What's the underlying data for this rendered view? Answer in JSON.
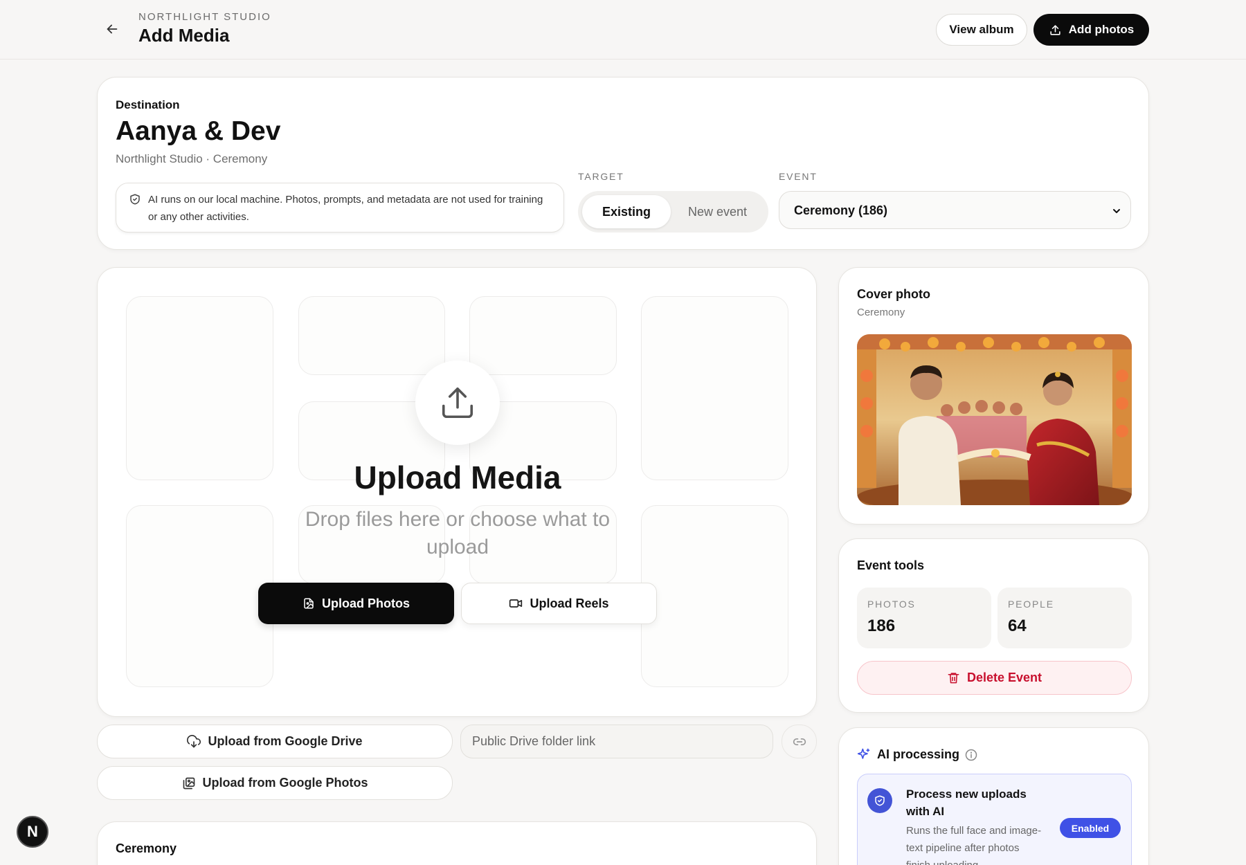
{
  "header": {
    "studio": "NORTHLIGHT STUDIO",
    "title": "Add Media",
    "view_album": "View album",
    "add_photos": "Add photos"
  },
  "destination": {
    "label": "Destination",
    "title": "Aanya & Dev",
    "subtitle": "Northlight Studio · Ceremony",
    "privacy_note": "AI runs on our local machine. Photos, prompts, and metadata are not used for training or any other activities.",
    "target_label": "TARGET",
    "target_options": [
      "Existing",
      "New event"
    ],
    "target_selected": "Existing",
    "event_label": "EVENT",
    "event_selected": "Ceremony (186)"
  },
  "upload": {
    "title": "Upload Media",
    "description": "Drop files here or choose what to upload",
    "upload_photos": "Upload Photos",
    "upload_reels": "Upload Reels",
    "google_drive": "Upload from Google Drive",
    "google_photos": "Upload from Google Photos",
    "drive_placeholder": "Public Drive folder link"
  },
  "ceremony_section": {
    "title": "Ceremony"
  },
  "cover": {
    "title": "Cover photo",
    "subtitle": "Ceremony"
  },
  "tools": {
    "title": "Event tools",
    "photos_label": "PHOTOS",
    "photos_value": "186",
    "people_label": "PEOPLE",
    "people_value": "64",
    "delete": "Delete Event"
  },
  "ai": {
    "title": "AI processing",
    "box_title": "Process new uploads with AI",
    "box_desc": "Runs the full face and image-text pipeline after photos finish uploading",
    "toggle": "Enabled"
  },
  "badge": {
    "letter": "N"
  },
  "colors": {
    "primary": "#0b0b0b",
    "danger": "#c8102e",
    "ai_accent": "#3f51e6",
    "background": "#f7f6f5"
  },
  "icons": {
    "back": "arrow-left-icon",
    "upload": "upload-icon",
    "shield": "shield-check-icon",
    "chevron": "chevron-down-icon",
    "photo": "image-file-icon",
    "video": "video-camera-icon",
    "cloud": "cloud-download-icon",
    "gallery": "gallery-icon",
    "link": "link-icon",
    "trash": "trash-icon",
    "sparkle": "sparkle-icon",
    "info": "info-icon"
  }
}
